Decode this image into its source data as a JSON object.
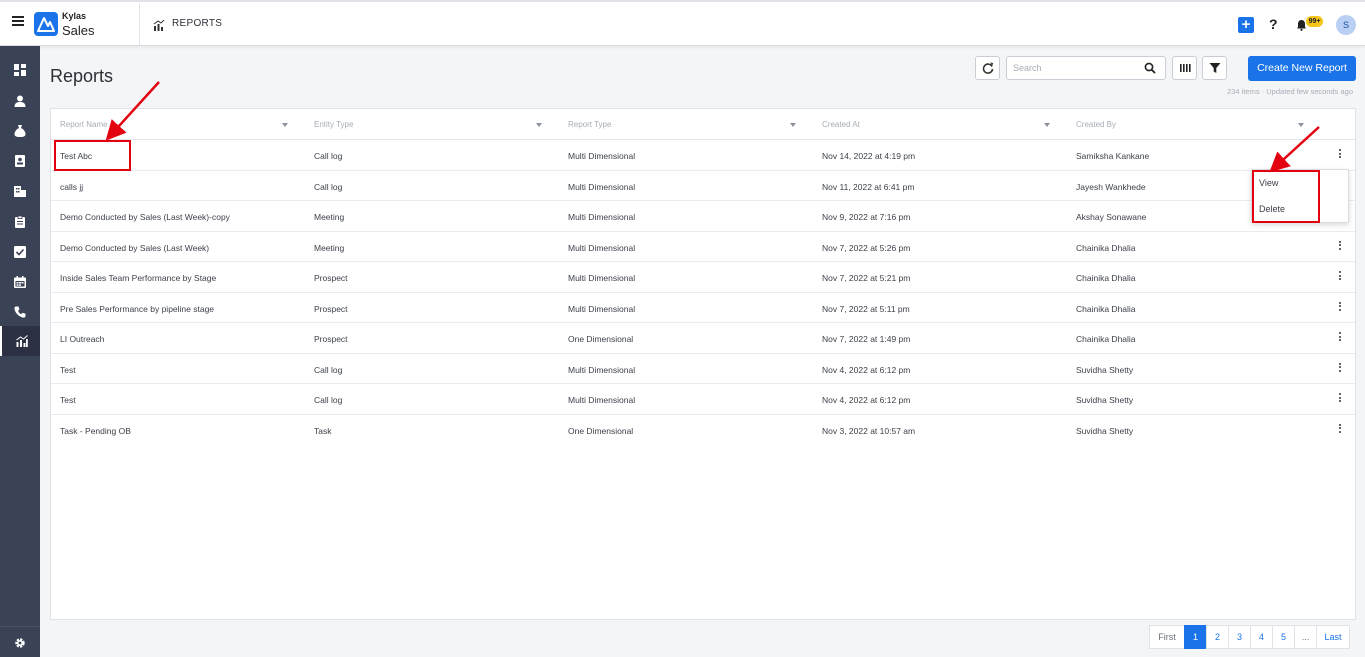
{
  "app": {
    "brand_top": "Kylas",
    "brand_bottom": "Sales"
  },
  "header": {
    "breadcrumb": "REPORTS",
    "notifications_badge": "99+",
    "avatar_initial": "S"
  },
  "page": {
    "title": "Reports",
    "search_placeholder": "Search",
    "create_button": "Create New Report",
    "meta": "234 items · Updated few seconds ago"
  },
  "table": {
    "columns": [
      "Report Name",
      "Entity Type",
      "Report Type",
      "Created At",
      "Created By"
    ],
    "rows": [
      [
        "Test Abc",
        "Call log",
        "Multi Dimensional",
        "Nov 14, 2022 at 4:19 pm",
        "Samiksha Kankane"
      ],
      [
        "calls jj",
        "Call log",
        "Multi Dimensional",
        "Nov 11, 2022 at 6:41 pm",
        "Jayesh Wankhede"
      ],
      [
        "Demo Conducted by Sales (Last Week)-copy",
        "Meeting",
        "Multi Dimensional",
        "Nov 9, 2022 at 7:16 pm",
        "Akshay Sonawane"
      ],
      [
        "Demo Conducted by Sales (Last Week)",
        "Meeting",
        "Multi Dimensional",
        "Nov 7, 2022 at 5:26 pm",
        "Chainika Dhalia"
      ],
      [
        "Inside Sales Team Performance by Stage",
        "Prospect",
        "Multi Dimensional",
        "Nov 7, 2022 at 5:21 pm",
        "Chainika Dhalia"
      ],
      [
        "Pre Sales Performance by pipeline stage",
        "Prospect",
        "Multi Dimensional",
        "Nov 7, 2022 at 5:11 pm",
        "Chainika Dhalia"
      ],
      [
        "LI Outreach",
        "Prospect",
        "One Dimensional",
        "Nov 7, 2022 at 1:49 pm",
        "Chainika Dhalia"
      ],
      [
        "Test",
        "Call log",
        "Multi Dimensional",
        "Nov 4, 2022 at 6:12 pm",
        "Suvidha Shetty"
      ],
      [
        "Test",
        "Call log",
        "Multi Dimensional",
        "Nov 4, 2022 at 6:12 pm",
        "Suvidha Shetty"
      ],
      [
        "Task - Pending OB",
        "Task",
        "One Dimensional",
        "Nov 3, 2022 at 10:57 am",
        "Suvidha Shetty"
      ]
    ]
  },
  "row_menu": {
    "items": [
      "View",
      "Delete"
    ]
  },
  "pagination": {
    "items": [
      "First",
      "1",
      "2",
      "3",
      "4",
      "5",
      "...",
      "Last"
    ],
    "active": "1"
  },
  "colors": {
    "accent": "#1a73e8",
    "sidebar": "#3a4256",
    "annotation": "#e3000f"
  },
  "icons": {
    "sidebar": [
      "dashboard-icon",
      "contacts-icon",
      "deals-icon",
      "leads-icon",
      "companies-icon",
      "clipboard-icon",
      "tasks-icon",
      "calendar-icon",
      "phone-icon",
      "reports-icon"
    ],
    "sidebar_bottom": "settings-icon"
  }
}
